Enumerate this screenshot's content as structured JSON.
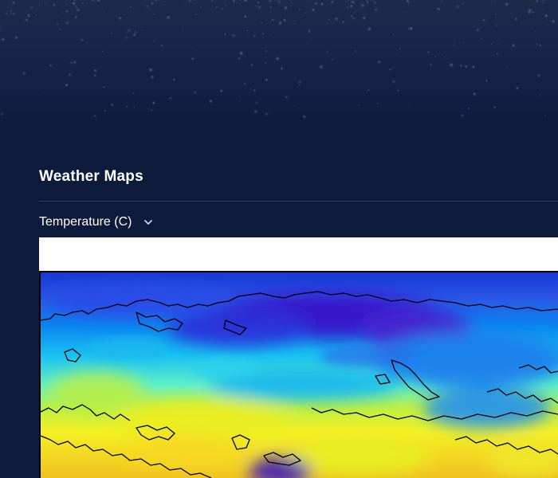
{
  "hero": {
    "image": "rain-droplets-background"
  },
  "section": {
    "title": "Weather Maps"
  },
  "selector": {
    "label": "Temperature (C)",
    "icon": "chevron-down-icon"
  },
  "map": {
    "region": "Europe and Asia",
    "variable": "temperature",
    "palette": [
      "#3a0fb8",
      "#2a3ad8",
      "#0b6cf0",
      "#00a8f0",
      "#1fd0f0",
      "#4ff0d8",
      "#a8f050",
      "#f0f028",
      "#f8d020",
      "#f0a020"
    ]
  }
}
